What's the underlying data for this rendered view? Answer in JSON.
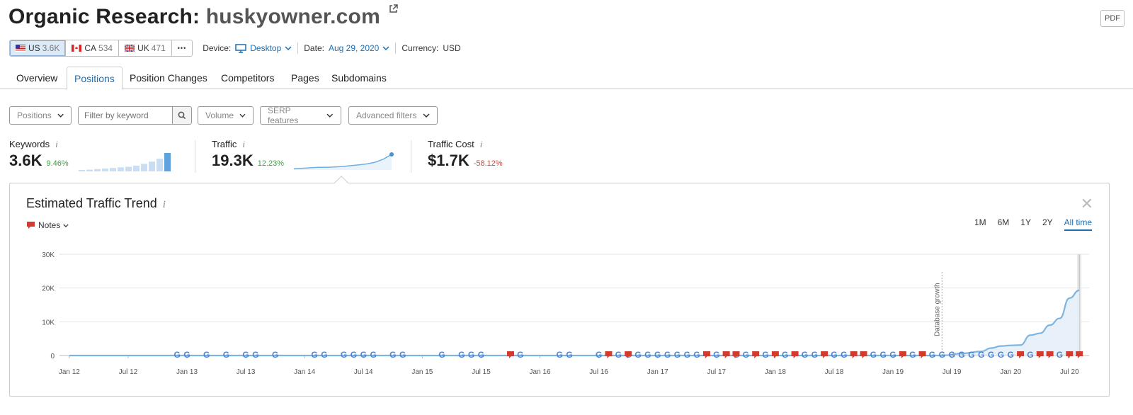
{
  "header": {
    "title_prefix": "Organic Research:",
    "domain": "huskyowner.com",
    "pdf_label": "PDF"
  },
  "databases": [
    {
      "code": "US",
      "count": "3.6K",
      "flag": "us-flag-icon",
      "active": true
    },
    {
      "code": "CA",
      "count": "534",
      "flag": "ca-flag-icon",
      "active": false
    },
    {
      "code": "UK",
      "count": "471",
      "flag": "uk-flag-icon",
      "active": false
    }
  ],
  "more_label": "•••",
  "device": {
    "label": "Device:",
    "value": "Desktop"
  },
  "date": {
    "label": "Date:",
    "value": "Aug 29, 2020"
  },
  "currency": {
    "label": "Currency:",
    "value": "USD"
  },
  "tabs": [
    "Overview",
    "Positions",
    "Position Changes",
    "Competitors",
    "Pages",
    "Subdomains"
  ],
  "active_tab": "Positions",
  "filters": {
    "positions": "Positions",
    "keyword_placeholder": "Filter by keyword",
    "volume": "Volume",
    "serp": "SERP features",
    "advanced": "Advanced filters"
  },
  "metrics": {
    "keywords": {
      "label": "Keywords",
      "value": "3.6K",
      "change": "9.46%"
    },
    "traffic": {
      "label": "Traffic",
      "value": "19.3K",
      "change": "12.23%"
    },
    "traffic_cost": {
      "label": "Traffic Cost",
      "value": "$1.7K",
      "change": "-58.12%"
    }
  },
  "sparklines": {
    "keywords_bars": [
      2,
      3,
      4,
      5,
      6,
      7,
      8,
      10,
      13,
      17,
      22,
      32
    ],
    "traffic_line": [
      3,
      4,
      5,
      6,
      6,
      7,
      8,
      10,
      12,
      14,
      18,
      25,
      36
    ]
  },
  "trend_panel": {
    "title": "Estimated Traffic Trend",
    "notes_label": "Notes",
    "periods": [
      "1M",
      "6M",
      "1Y",
      "2Y",
      "All time"
    ],
    "active_period": "All time",
    "annotation": "Database growth"
  },
  "colors": {
    "accent": "#1a6fb5",
    "line": "#7db4e0",
    "area": "#e6f0fa",
    "positive": "#3aa142",
    "negative": "#d0453a",
    "note_red": "#d23c2f"
  },
  "chart_data": {
    "type": "area",
    "title": "Estimated Traffic Trend",
    "xlabel": "",
    "ylabel": "",
    "x_ticks": [
      "Jan 12",
      "Jul 12",
      "Jan 13",
      "Jul 13",
      "Jan 14",
      "Jul 14",
      "Jan 15",
      "Jul 15",
      "Jan 16",
      "Jul 16",
      "Jan 17",
      "Jul 17",
      "Jan 18",
      "Jul 18",
      "Jan 19",
      "Jul 19",
      "Jan 20",
      "Jul 20"
    ],
    "x_range": [
      "2011-12",
      "2020-09"
    ],
    "ylim": [
      0,
      30000
    ],
    "y_ticks": [
      0,
      10000,
      20000,
      30000
    ],
    "y_tick_labels": [
      "0",
      "10K",
      "20K",
      "30K"
    ],
    "grid": true,
    "series": [
      {
        "x": [
          "2012-01",
          "2019-06",
          "2019-08",
          "2019-10",
          "2019-11",
          "2019-12",
          "2020-01",
          "2020-02",
          "2020-03",
          "2020-04",
          "2020-05",
          "2020-06",
          "2020-07",
          "2020-08"
        ],
        "values": [
          0,
          0,
          600,
          1200,
          2200,
          2800,
          3000,
          3100,
          6000,
          6600,
          9000,
          11000,
          17000,
          19300
        ]
      }
    ],
    "annotations": [
      {
        "x": "2019-06",
        "label": "Database growth"
      }
    ],
    "google_markers": [
      "2012-12",
      "2013-01",
      "2013-03",
      "2013-05",
      "2013-07",
      "2013-08",
      "2013-10",
      "2014-02",
      "2014-03",
      "2014-05",
      "2014-06",
      "2014-07",
      "2014-08",
      "2014-10",
      "2014-11",
      "2015-03",
      "2015-05",
      "2015-06",
      "2015-07",
      "2015-11",
      "2016-03",
      "2016-04",
      "2016-07",
      "2016-09",
      "2016-10",
      "2016-11",
      "2016-12",
      "2017-01",
      "2017-02",
      "2017-03",
      "2017-04",
      "2017-05",
      "2017-07",
      "2017-09",
      "2017-10",
      "2017-12",
      "2018-02",
      "2018-04",
      "2018-05",
      "2018-07",
      "2018-08",
      "2018-11",
      "2018-12",
      "2019-01",
      "2019-03",
      "2019-05",
      "2019-06",
      "2019-07",
      "2019-08",
      "2019-09",
      "2019-10",
      "2019-11",
      "2019-12",
      "2020-01",
      "2020-03",
      "2020-06"
    ],
    "note_markers": [
      "2015-10",
      "2016-08",
      "2016-10",
      "2017-06",
      "2017-08",
      "2017-09",
      "2017-11",
      "2018-01",
      "2018-03",
      "2018-06",
      "2018-09",
      "2018-10",
      "2019-02",
      "2019-04",
      "2020-02",
      "2020-04",
      "2020-05",
      "2020-07",
      "2020-08"
    ]
  }
}
